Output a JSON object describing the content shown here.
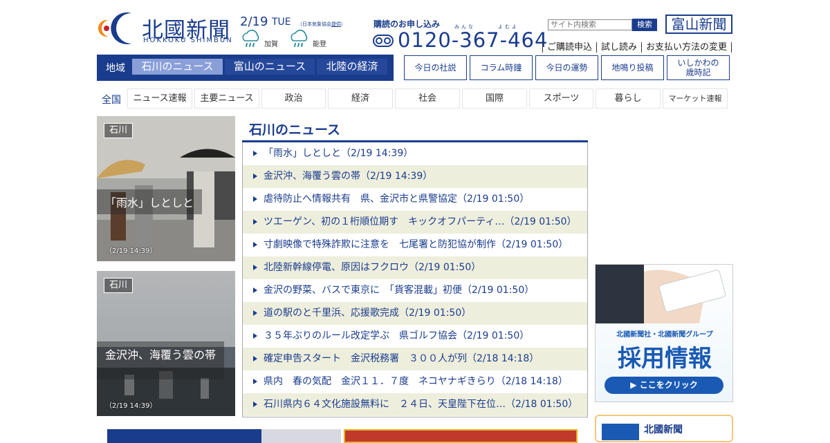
{
  "header": {
    "logo_ja": "北國新聞",
    "logo_en": "HOKKOKU SHIMBUN",
    "date": "2/19",
    "day": "TUE",
    "weather_credit_prefix": "（日本気象協会",
    "weather_credit_link": "提供",
    "weather_credit_suffix": "）",
    "weather": [
      {
        "area": "加賀",
        "icon": "rain-icon"
      },
      {
        "area": "能登",
        "icon": "rain-icon"
      }
    ],
    "subscription_title": "購読のお申し込み",
    "ruby_1": "みんな",
    "ruby_2": "よむよ",
    "phone": "0120-367-464",
    "search_placeholder": "サイト内検索",
    "search_button": "検索",
    "toyama_link": "富山新聞",
    "links": [
      "ご購読申込",
      "試し読み",
      "お支払い方法の変更"
    ]
  },
  "region_nav": {
    "label": "地域",
    "tabs": [
      "石川のニュース",
      "富山のニュース",
      "北陸の経済"
    ],
    "active_index": 0
  },
  "column_nav": [
    "今日の社説",
    "コラム時鐘",
    "今日の運勢",
    "地鳴り投稿",
    "いしかわの\n歳時記"
  ],
  "national_nav": {
    "label": "全国",
    "tabs": [
      "ニュース速報",
      "主要ニュース",
      "政治",
      "経済",
      "社会",
      "国際",
      "スポーツ",
      "暮らし",
      "マーケット速報"
    ]
  },
  "photos": [
    {
      "tag": "石川",
      "caption": "「雨水」しとしと",
      "time": "（2/19 14:39）"
    },
    {
      "tag": "石川",
      "caption": "金沢沖、海覆う雲の帯",
      "time": "（2/19 14:39）"
    }
  ],
  "news": {
    "title": "石川のニュース",
    "items": [
      "「雨水」しとしと（2/19 14:39）",
      "金沢沖、海覆う雲の帯（2/19 14:39）",
      "虐待防止へ情報共有　県、金沢市と県警協定（2/19 01:50）",
      "ツエーゲン、初の１桁順位期す　キックオフパーティ…（2/19 01:50）",
      "寸劇映像で特殊詐欺に注意を　七尾署と防犯協が制作（2/19 01:50）",
      "北陸新幹線停電、原因はフクロウ（2/19 01:50）",
      "金沢の野菜、バスで東京に　「貨客混載」初便（2/19 01:50）",
      "道の駅のと千里浜、応援歌完成（2/19 01:50）",
      "３５年ぶりのルール改定学ぶ　県ゴルフ協会（2/19 01:50）",
      "確定申告スタート　金沢税務署　３００人が列（2/18 14:18）",
      "県内　春の気配　金沢１１．７度　ネコヤナギきらり（2/18 14:18）",
      "石川県内６４文化施設無料に　２４日、天皇陛下在位…（2/18 01:50）"
    ]
  },
  "recruit": {
    "sub": "北國新聞社・北國新聞グループ",
    "title": "採用情報",
    "button": "▶ ここをクリック"
  },
  "company": {
    "name": "北國新聞"
  },
  "colors": {
    "brand": "#1a3c8c",
    "active_tab": "#8a9fd8",
    "row_alt": "#eeeedd"
  }
}
